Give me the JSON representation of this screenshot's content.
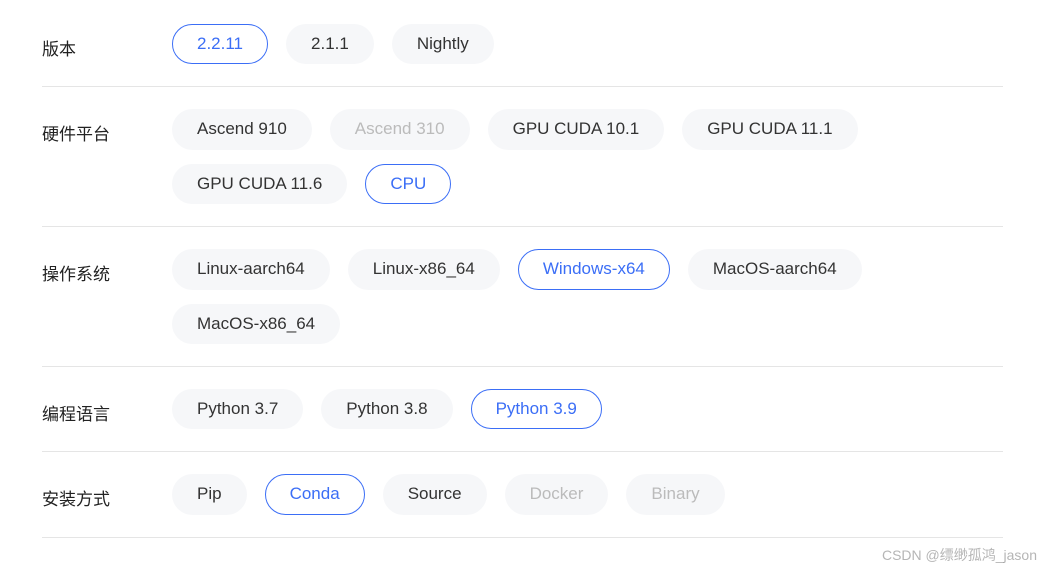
{
  "rows": [
    {
      "label": "版本",
      "options": [
        {
          "text": "2.2.11",
          "state": "selected"
        },
        {
          "text": "2.1.1",
          "state": "normal"
        },
        {
          "text": "Nightly",
          "state": "normal"
        }
      ]
    },
    {
      "label": "硬件平台",
      "options": [
        {
          "text": "Ascend 910",
          "state": "normal"
        },
        {
          "text": "Ascend 310",
          "state": "disabled"
        },
        {
          "text": "GPU CUDA 10.1",
          "state": "normal"
        },
        {
          "text": "GPU CUDA 11.1",
          "state": "normal"
        },
        {
          "text": "GPU CUDA 11.6",
          "state": "normal"
        },
        {
          "text": "CPU",
          "state": "selected"
        }
      ]
    },
    {
      "label": "操作系统",
      "options": [
        {
          "text": "Linux-aarch64",
          "state": "normal"
        },
        {
          "text": "Linux-x86_64",
          "state": "normal"
        },
        {
          "text": "Windows-x64",
          "state": "selected"
        },
        {
          "text": "MacOS-aarch64",
          "state": "normal"
        },
        {
          "text": "MacOS-x86_64",
          "state": "normal"
        }
      ]
    },
    {
      "label": "编程语言",
      "options": [
        {
          "text": "Python 3.7",
          "state": "normal"
        },
        {
          "text": "Python 3.8",
          "state": "normal"
        },
        {
          "text": "Python 3.9",
          "state": "selected"
        }
      ]
    },
    {
      "label": "安装方式",
      "options": [
        {
          "text": "Pip",
          "state": "normal"
        },
        {
          "text": "Conda",
          "state": "selected"
        },
        {
          "text": "Source",
          "state": "normal"
        },
        {
          "text": "Docker",
          "state": "disabled"
        },
        {
          "text": "Binary",
          "state": "disabled"
        }
      ]
    }
  ],
  "watermark": "CSDN @缥缈孤鸿_jason"
}
